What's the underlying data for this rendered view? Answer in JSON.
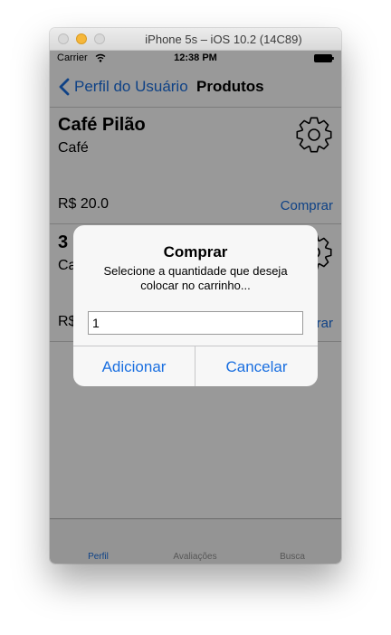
{
  "window": {
    "title": "iPhone 5s – iOS 10.2 (14C89)"
  },
  "status_bar": {
    "carrier": "Carrier",
    "time": "12:38 PM",
    "icons": [
      "wifi-icon",
      "battery-icon"
    ]
  },
  "nav_bar": {
    "back_label": "Perfil do Usuário",
    "title": "Produtos",
    "back_icon": "chevron-left-icon"
  },
  "products": [
    {
      "name": "Café Pilão",
      "category": "Café",
      "price": "R$ 20.0",
      "action": "Comprar",
      "icon": "gear-icon"
    },
    {
      "name": "3",
      "category": "Ca",
      "price": "R$",
      "action": "rar",
      "icon": "gear-icon"
    }
  ],
  "tab_bar": {
    "tabs": [
      {
        "label": "Perfil",
        "active": true
      },
      {
        "label": "Avaliações",
        "active": false
      },
      {
        "label": "Busca",
        "active": false
      }
    ]
  },
  "alert": {
    "title": "Comprar",
    "message": "Selecione a quantidade que deseja colocar no carrinho...",
    "input_value": "1",
    "confirm_label": "Adicionar",
    "cancel_label": "Cancelar"
  },
  "colors": {
    "accent": "#1a6fe0",
    "overlay": "rgba(0,0,0,0.4)",
    "alert_bg": "#f7f7f7"
  }
}
